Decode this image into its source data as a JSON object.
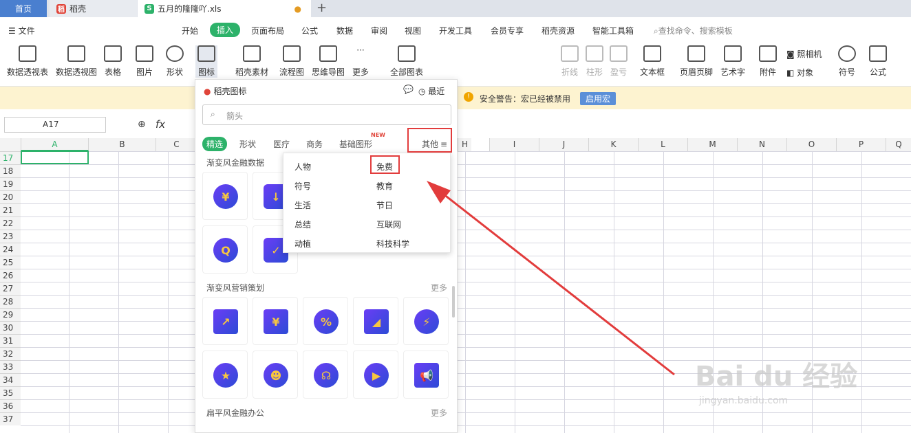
{
  "tabs": {
    "home": "首页",
    "daoke": "稻壳",
    "file": "五月的隆隆吖.xls"
  },
  "menu": {
    "file": "文件",
    "items": [
      "开始",
      "插入",
      "页面布局",
      "公式",
      "数据",
      "审阅",
      "视图",
      "开发工具",
      "会员专享",
      "稻壳资源",
      "智能工具箱"
    ],
    "active": "插入",
    "search": "查找命令、搜索模板"
  },
  "ribbon": [
    "数据透视表",
    "数据透视图",
    "表格",
    "图片",
    "形状",
    "图标",
    "稻壳素材",
    "流程图",
    "思维导图",
    "更多",
    "全部图表",
    "折线",
    "柱形",
    "盈亏",
    "文本框",
    "页眉页脚",
    "艺术字",
    "附件",
    "照相机",
    "对象",
    "符号",
    "公式"
  ],
  "warning": {
    "text": "安全警告：宏已经被禁用",
    "button": "启用宏"
  },
  "namebox": "A17",
  "fx": "fx",
  "columns": [
    "A",
    "B",
    "C",
    "H",
    "I",
    "J",
    "K",
    "L",
    "M",
    "N",
    "O",
    "P",
    "Q"
  ],
  "rows": [
    "17",
    "18",
    "19",
    "20",
    "21",
    "22",
    "23",
    "24",
    "25",
    "26",
    "27",
    "28",
    "29",
    "30",
    "31",
    "32",
    "33",
    "34",
    "35",
    "36",
    "37"
  ],
  "panel": {
    "title": "稻壳图标",
    "recent": "最近",
    "search_placeholder": "箭头",
    "categories": [
      "精选",
      "形状",
      "医疗",
      "商务",
      "基础图形"
    ],
    "new_badge": "NEW",
    "other": "其他",
    "sections": [
      "渐变风金融数据",
      "渐变风营销策划",
      "扁平风金融办公"
    ],
    "more": "更多"
  },
  "dropdown": {
    "left": [
      "人物",
      "符号",
      "生活",
      "总结",
      "动植"
    ],
    "right": [
      "免费",
      "教育",
      "节日",
      "互联网",
      "科技科学"
    ]
  },
  "watermark": {
    "logo": "Bai du 经验",
    "url": "jingyan.baidu.com"
  },
  "colors": {
    "accent": "#2db26a",
    "highlight": "#e23c3c"
  }
}
